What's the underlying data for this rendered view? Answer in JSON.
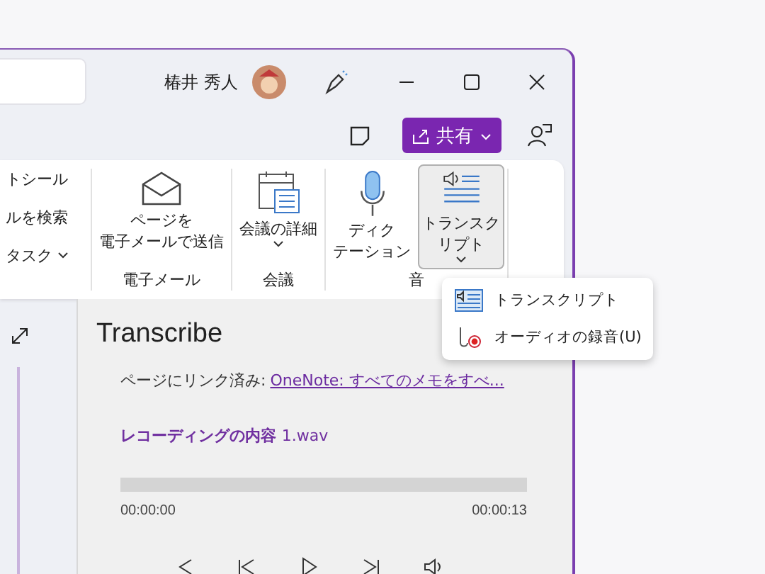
{
  "title_bar": {
    "user_name": "椿井 秀人"
  },
  "share_button": {
    "label": "共有"
  },
  "ribbon": {
    "left_items": [
      {
        "label": "トシール",
        "caret": false
      },
      {
        "label": "ルを検索",
        "caret": false
      },
      {
        "label": "タスク",
        "caret": true
      }
    ],
    "groups": [
      {
        "name": "電子メール",
        "buttons": [
          {
            "kind": "envelope",
            "lines": [
              "ページを",
              "電子メールで送信"
            ],
            "caret": false,
            "selected": false
          }
        ]
      },
      {
        "name": "会議",
        "buttons": [
          {
            "kind": "calendar",
            "lines": [
              "会議の詳細"
            ],
            "caret": true,
            "selected": false
          }
        ]
      },
      {
        "name": "音",
        "buttons": [
          {
            "kind": "mic",
            "lines": [
              "ディク",
              "テーション"
            ],
            "caret": false,
            "selected": false
          },
          {
            "kind": "transcript",
            "lines": [
              "トランスク",
              "リプト"
            ],
            "caret": true,
            "selected": true
          }
        ]
      }
    ]
  },
  "menu": [
    {
      "kind": "transcript",
      "label": "トランスクリプト"
    },
    {
      "kind": "record",
      "label": "オーディオの録音(U)"
    }
  ],
  "pane": {
    "title": "Transcribe",
    "linked_label": "ページにリンク済み:",
    "link": "OneNote: すべてのメモをすべ...",
    "recording_title": "レコーディングの内容",
    "file": "1.wav",
    "time_start": "00:00:00",
    "time_end": "00:00:13"
  }
}
